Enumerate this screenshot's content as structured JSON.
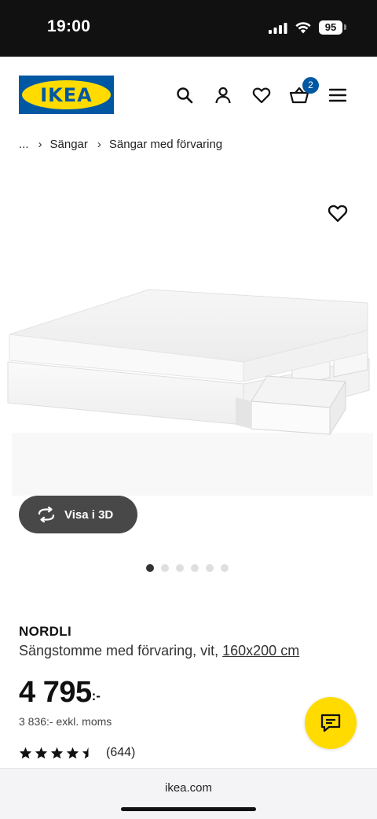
{
  "status_bar": {
    "time": "19:00",
    "battery": "95",
    "icons": [
      "cellular-signal-icon",
      "wifi-icon",
      "battery-icon"
    ]
  },
  "header": {
    "logo_text": "IKEA",
    "icons": [
      "search-icon",
      "profile-icon",
      "heart-icon",
      "cart-icon",
      "menu-icon"
    ],
    "cart_count": "2"
  },
  "breadcrumb": {
    "items": [
      "...",
      "Sängar",
      "Sängar med förvaring"
    ]
  },
  "gallery": {
    "image": "bed-frame-with-storage-drawers",
    "view_3d_label": "Visa i 3D",
    "dots_total": 6,
    "active_dot": 1
  },
  "product": {
    "name": "NORDLI",
    "description": "Sängstomme med förvaring, vit,",
    "size_link": "160x200 cm",
    "price": "4 795",
    "price_suffix": ":-",
    "price_exkl": "3 836:- exkl. moms",
    "rating_value": 4.5,
    "rating_max": 5,
    "review_count": "(644)"
  },
  "browser": {
    "address": "ikea.com"
  },
  "colors": {
    "ikea_blue": "#0058a3",
    "ikea_yellow": "#ffdb00",
    "view3d_bg": "#484848"
  }
}
